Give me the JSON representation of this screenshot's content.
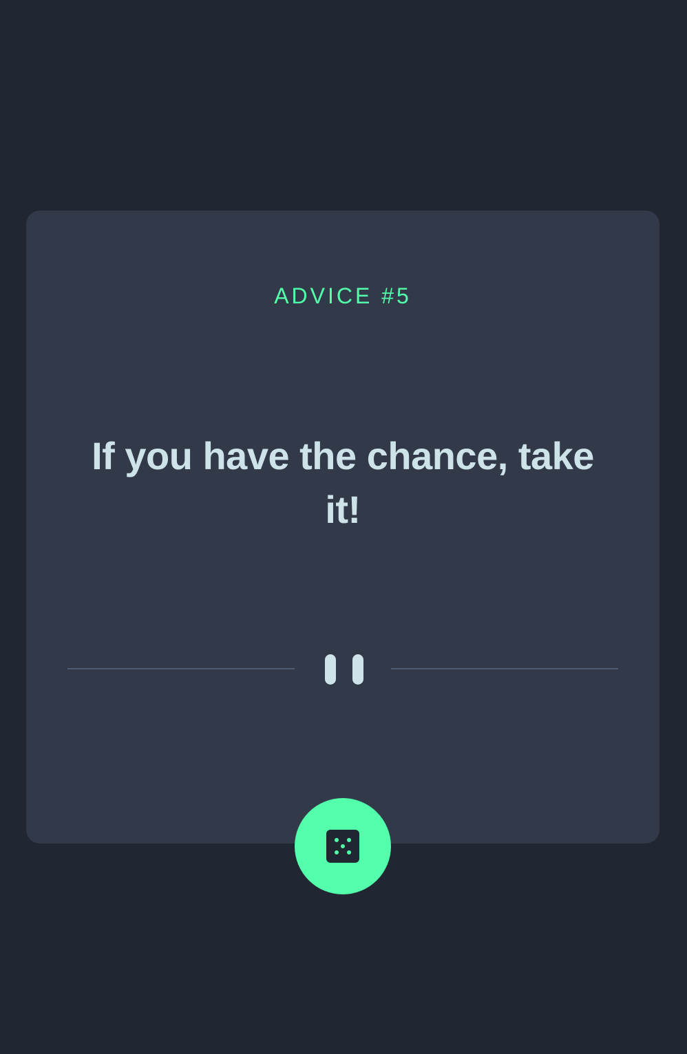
{
  "advice": {
    "id_label": "ADVICE #5",
    "text": "If you have the chance, take it!"
  },
  "controls": {
    "generate_icon": "dice-icon",
    "divider_icon": "pause-icon"
  },
  "colors": {
    "background": "#202632",
    "card": "#323A49",
    "accent": "#53FFAA",
    "text": "#CEE3E9",
    "divider": "#4F5D74"
  }
}
